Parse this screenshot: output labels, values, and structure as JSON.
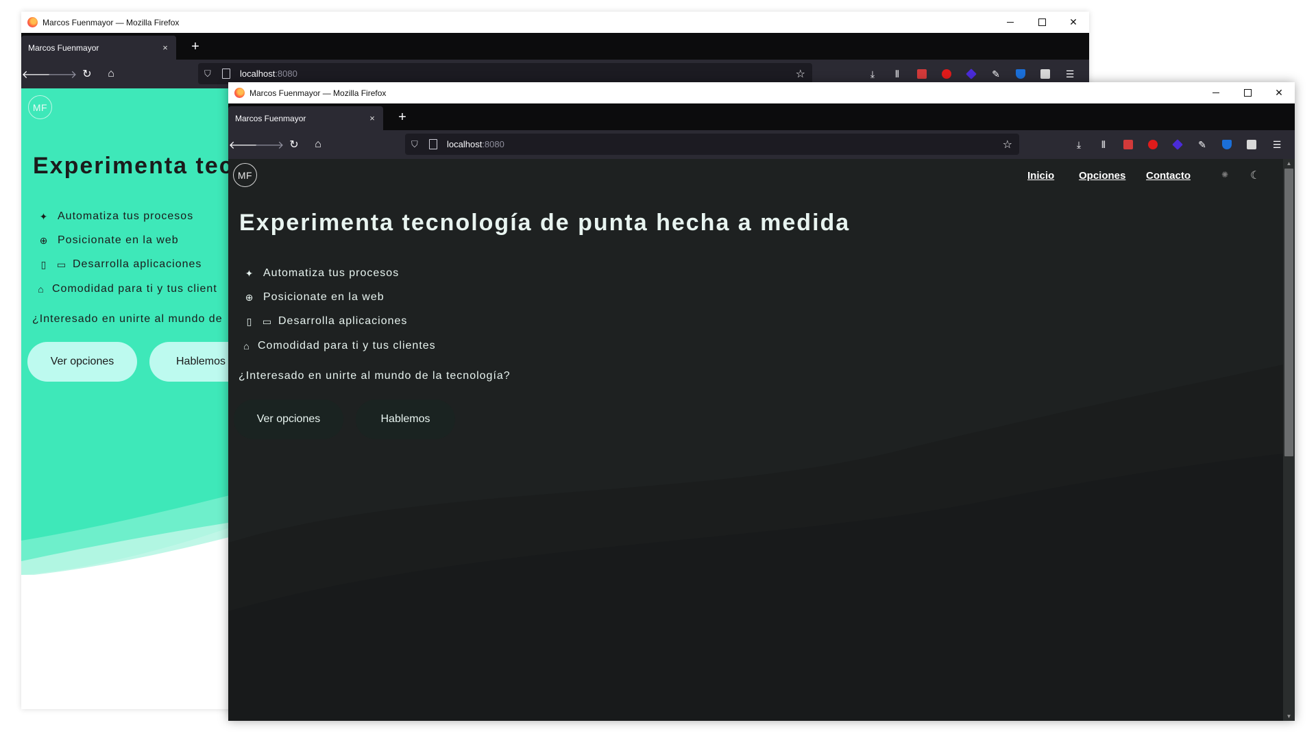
{
  "window_title": "Marcos Fuenmayor — Mozilla Firefox",
  "window_controls": {
    "minimize": "—",
    "maximize": "☐",
    "close": "✕"
  },
  "tab": {
    "title": "Marcos Fuenmayor",
    "close": "×"
  },
  "new_tab": "+",
  "url": {
    "host": "localhost",
    "port": ":8080"
  },
  "nav_icons": [
    "back-arrow-icon",
    "forward-arrow-icon",
    "reload-icon",
    "home-icon"
  ],
  "toolbar_icons": [
    "download-icon",
    "library-icon",
    "extension-red-icon",
    "extension-opera-icon",
    "extension-diamond-icon",
    "pen-icon",
    "shield-extension-icon",
    "extension-window-icon",
    "menu-icon"
  ],
  "colors": {
    "teal_hero": "#3ee8b9",
    "cta_light": "#bdfaef",
    "dark_bg": "#1e2121",
    "cta_dark": "#1a2321",
    "firefox_dark": "#2b2a33"
  },
  "site": {
    "logo": "MF",
    "nav": [
      "Inicio",
      "Opciones",
      "Contacto"
    ],
    "title": "Experimenta tecnología de punta hecha a medida",
    "back_title_visible": "Experimenta tec",
    "features": [
      {
        "icon": "magic-wand-icon",
        "text": "Automatiza tus procesos"
      },
      {
        "icon": "globe-icon",
        "text": "Posicionate en la web"
      },
      {
        "icon": "devices-icon",
        "text": "Desarrolla aplicaciones"
      },
      {
        "icon": "store-icon",
        "text": "Comodidad para ti y tus clientes"
      }
    ],
    "back_feature_last_visible": "Comodidad para ti y tus client",
    "tagline": "¿Interesado en unirte al mundo de la tecnología?",
    "back_tagline_visible": "¿Interesado en unirte al mundo de",
    "buttons": [
      "Ver opciones",
      "Hablemos"
    ]
  }
}
